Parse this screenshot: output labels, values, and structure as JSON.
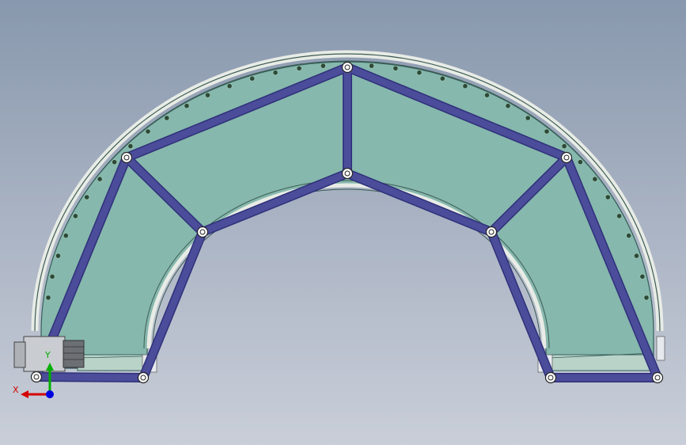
{
  "viewport": {
    "background_top": "#8898ad",
    "background_bottom": "#c9ced8"
  },
  "model": {
    "description_icon": "curved-conveyor-frame",
    "colors": {
      "frame": "#4b4d9a",
      "frame_edge": "#2f307a",
      "panel": "#7fb3a9",
      "panel_edge": "#365f5a",
      "belt_edge": "#e8ece6",
      "roller": "#2c4a36",
      "joint": "#ffffff"
    }
  },
  "motor": {
    "icon": "motor-gearbox-icon"
  },
  "triad": {
    "x_label": "X",
    "y_label": "Y",
    "x_color": "#d40000",
    "y_color": "#00b000",
    "z_color": "#0000e0"
  }
}
